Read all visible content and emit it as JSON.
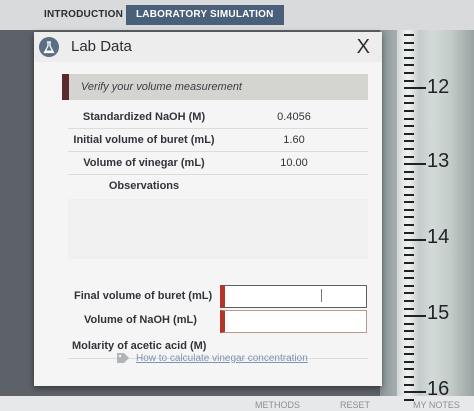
{
  "tabs": [
    {
      "label": "INTRODUCTION",
      "active": false
    },
    {
      "label": "LABORATORY SIMULATION",
      "active": true
    }
  ],
  "dialog": {
    "title": "Lab Data",
    "close_label": "X",
    "banner": "Verify your volume measurement",
    "rows": [
      {
        "label": "Standardized NaOH (M)",
        "value": "0.4056"
      },
      {
        "label": "Initial volume of buret (mL)",
        "value": "1.60"
      },
      {
        "label": "Volume of vinegar (mL)",
        "value": "10.00"
      }
    ],
    "observations_label": "Observations",
    "inputs": [
      {
        "label": "Final volume of buret (mL)",
        "value": ""
      },
      {
        "label": "Volume of NaOH (mL)",
        "value": ""
      }
    ],
    "molarity_label": "Molarity of acetic acid (M)",
    "link_label": "How to calculate vinegar concentration"
  },
  "buret": {
    "scale": [
      "12",
      "13",
      "14",
      "15",
      "16"
    ]
  },
  "bottom": {
    "items": [
      "METHODS",
      "RESET",
      "MY NOTES"
    ]
  },
  "colors": {
    "active_tab": "#4a5f7a",
    "required_marker": "#b3352a",
    "banner_marker": "#5b2a2a"
  }
}
